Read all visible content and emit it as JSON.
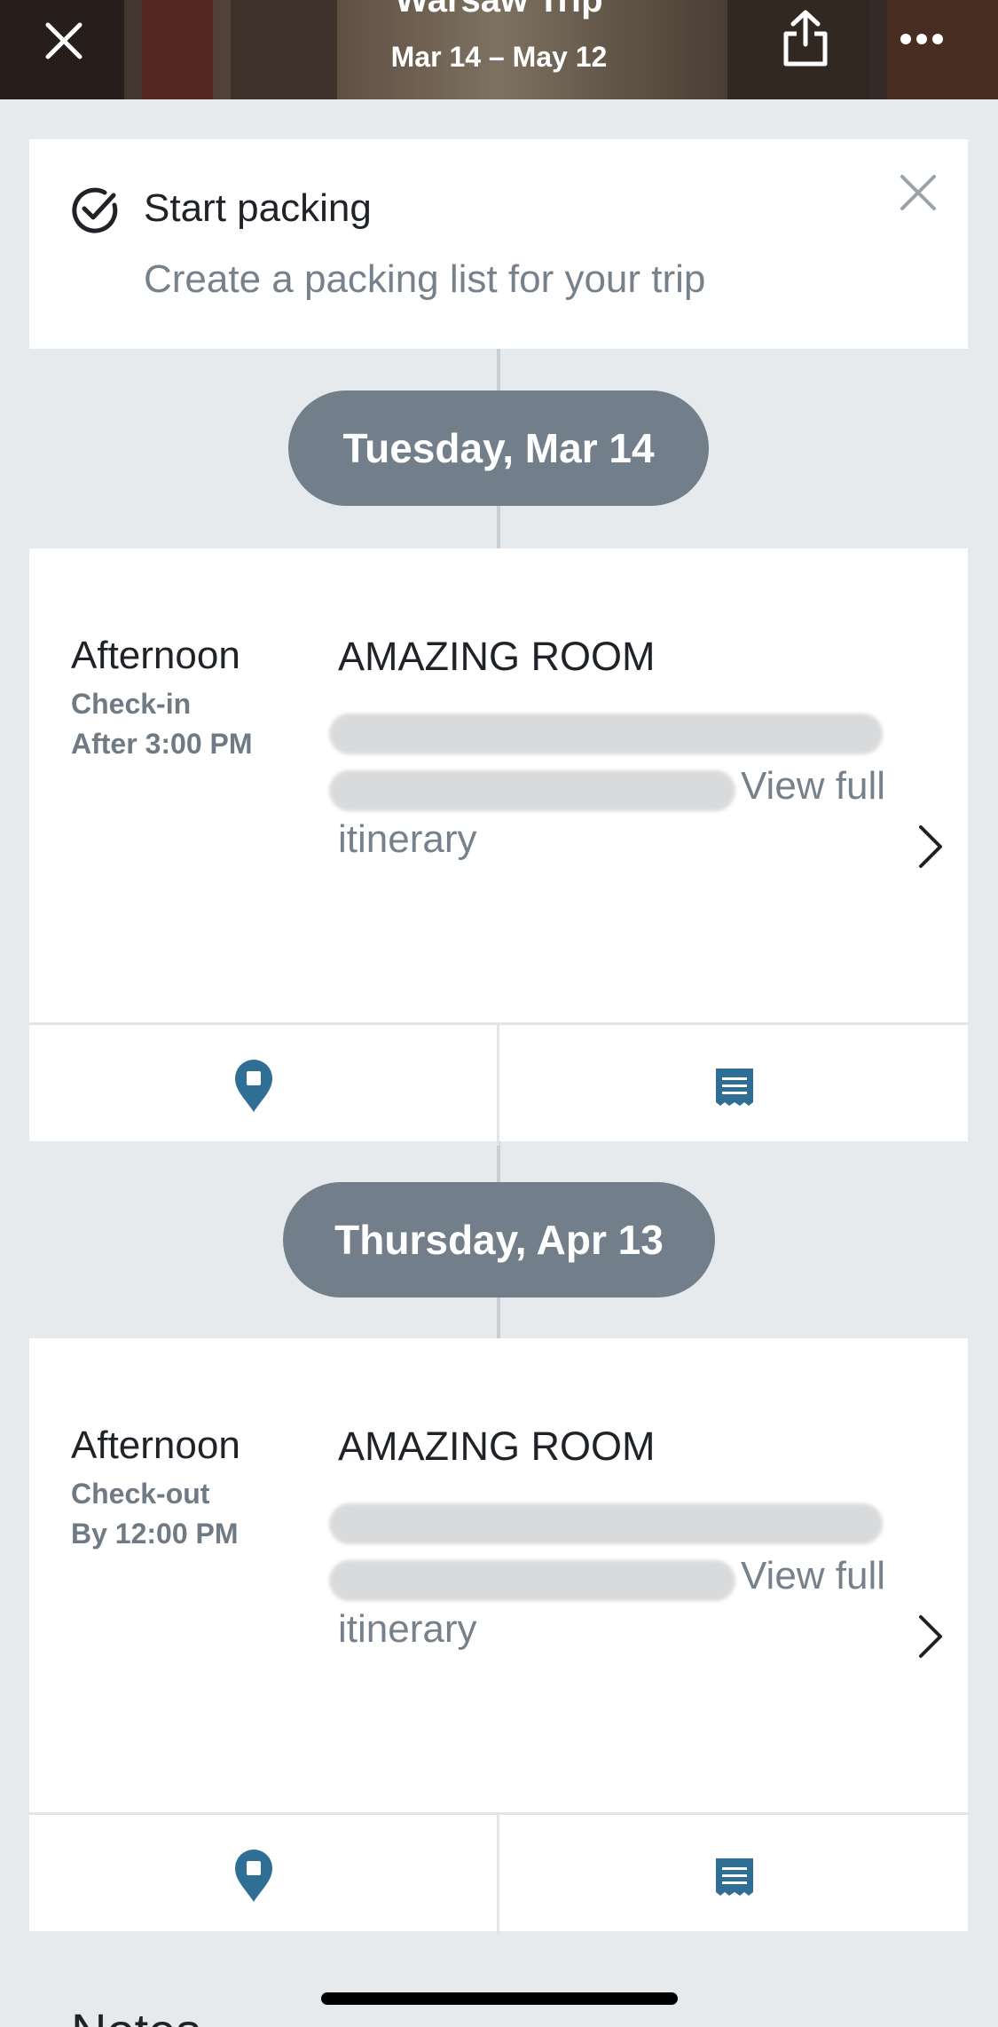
{
  "header": {
    "title": "Warsaw Trip",
    "dates": "Mar 14 – May 12"
  },
  "packing": {
    "title": "Start packing",
    "subtitle": "Create a packing list for your trip"
  },
  "days": [
    {
      "date": "Tuesday, Mar 14",
      "segment": {
        "time": "Afternoon",
        "label": "Check-in",
        "detail": "After 3:00 PM",
        "name": "AMAZING ROOM",
        "link_part1": "View full",
        "link_part2": "itinerary"
      }
    },
    {
      "date": "Thursday, Apr 13",
      "segment": {
        "time": "Afternoon",
        "label": "Check-out",
        "detail": "By 12:00 PM",
        "name": "AMAZING ROOM",
        "link_part1": "View full",
        "link_part2": "itinerary"
      }
    }
  ],
  "notes": {
    "heading": "Notes"
  },
  "colors": {
    "accent": "#2f6f96",
    "pill": "#727f8a",
    "muted_text": "#77818b",
    "background": "#e7eaed"
  },
  "icons": {
    "close": "close-icon",
    "share": "share-icon",
    "more": "more-icon",
    "check": "check-circle-icon",
    "map": "map-pin-icon",
    "receipt": "receipt-icon",
    "chevron": "chevron-right-icon"
  }
}
